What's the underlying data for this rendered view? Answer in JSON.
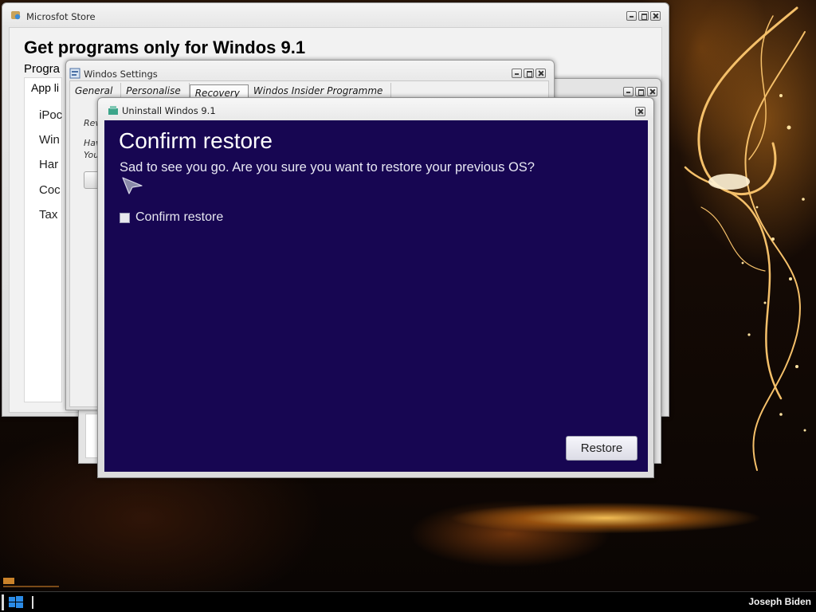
{
  "store": {
    "title": "Microsfot Store",
    "heading": "Get programs only for Windos 9.1",
    "programs_label": "Progra",
    "list_header": "App li",
    "items": [
      "iPoc",
      "Win",
      "Har",
      "Coc",
      "Tax"
    ]
  },
  "settings": {
    "title": "Windos Settings",
    "tabs": [
      "General",
      "Personalise",
      "Recovery",
      "Windos Insider Programme"
    ],
    "active_tab": "Recovery",
    "text_lines": [
      "Rev",
      "Hav",
      "You"
    ]
  },
  "dialog": {
    "title": "Uninstall Windos 9.1",
    "heading": "Confirm restore",
    "question": "Sad to see you go. Are you sure you want to restore your previous OS?",
    "checkbox_label": "Confirm restore",
    "checkbox_checked": false,
    "restore_button": "Restore"
  },
  "taskbar": {
    "user": "Joseph Biden",
    "start_icon": "windows-logo-icon"
  },
  "colors": {
    "dialog_background": "#170652",
    "taskbar": "#000000"
  }
}
